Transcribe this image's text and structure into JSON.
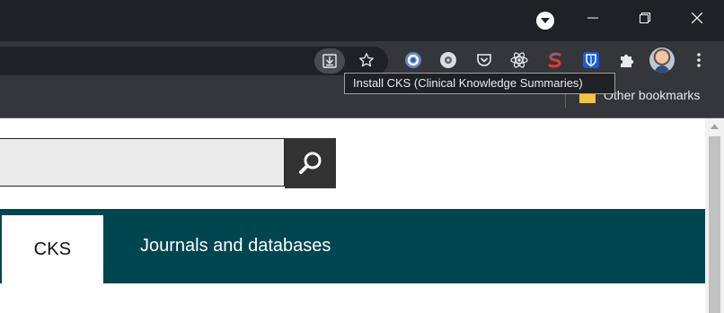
{
  "browser": {
    "tooltip": "Install CKS (Clinical Knowledge Summaries)",
    "bookmarks": {
      "other_label": "Other bookmarks"
    },
    "icons": {
      "profile": "chevron-down-icon",
      "minimize": "minimize-icon",
      "maximize": "restore-icon",
      "close": "close-icon",
      "install": "install-app-icon",
      "star": "star-icon",
      "ext1": "loop-extension-icon",
      "ext2": "gear-extension-icon",
      "ext3": "pocket-icon",
      "ext4": "react-icon",
      "ext5": "s-extension-icon",
      "ext6": "bitwarden-shield-icon",
      "puzzle": "extensions-icon",
      "menu": "kebab-menu-icon"
    }
  },
  "page": {
    "search": {
      "value": "",
      "button_icon": "search-icon"
    },
    "nav": {
      "tabs": [
        {
          "label": "CKS",
          "active": true
        },
        {
          "label": "Journals and databases",
          "active": false
        }
      ]
    }
  },
  "colors": {
    "nav_background": "#004650",
    "chrome_dark": "#202124",
    "toolbar": "#35363a"
  }
}
